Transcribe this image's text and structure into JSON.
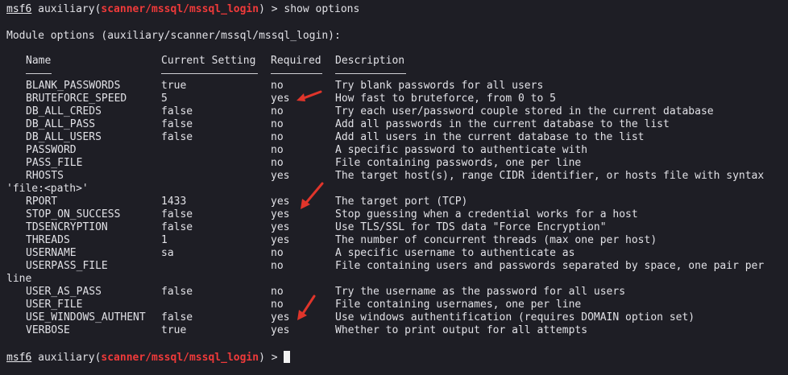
{
  "terminal": {
    "prompt_name": "msf6",
    "prompt_module_prefix": " auxiliary(",
    "module_path": "scanner/mssql/mssql_login",
    "prompt_suffix": ") > ",
    "command": "show options",
    "options_title": "Module options (auxiliary/scanner/mssql/mssql_login):",
    "cursor_prompt_suffix": ") > "
  },
  "table": {
    "headers": {
      "name": "Name",
      "current": "Current Setting",
      "required": "Required",
      "description": "Description"
    },
    "rows": [
      {
        "name": "BLANK_PASSWORDS",
        "current": "true",
        "required": "no",
        "description": "Try blank passwords for all users"
      },
      {
        "name": "BRUTEFORCE_SPEED",
        "current": "5",
        "required": "yes",
        "description": "How fast to bruteforce, from 0 to 5"
      },
      {
        "name": "DB_ALL_CREDS",
        "current": "false",
        "required": "no",
        "description": "Try each user/password couple stored in the current database"
      },
      {
        "name": "DB_ALL_PASS",
        "current": "false",
        "required": "no",
        "description": "Add all passwords in the current database to the list"
      },
      {
        "name": "DB_ALL_USERS",
        "current": "false",
        "required": "no",
        "description": "Add all users in the current database to the list"
      },
      {
        "name": "PASSWORD",
        "current": "",
        "required": "no",
        "description": "A specific password to authenticate with"
      },
      {
        "name": "PASS_FILE",
        "current": "",
        "required": "no",
        "description": "File containing passwords, one per line"
      },
      {
        "name": "RHOSTS",
        "current": "",
        "required": "yes",
        "description": "The target host(s), range CIDR identifier, or hosts file with syntax"
      },
      {
        "name": "",
        "current": "",
        "required": "",
        "description": "",
        "wrap": "'file:<path>'"
      },
      {
        "name": "RPORT",
        "current": "1433",
        "required": "yes",
        "description": "The target port (TCP)"
      },
      {
        "name": "STOP_ON_SUCCESS",
        "current": "false",
        "required": "yes",
        "description": "Stop guessing when a credential works for a host"
      },
      {
        "name": "TDSENCRYPTION",
        "current": "false",
        "required": "yes",
        "description": "Use TLS/SSL for TDS data \"Force Encryption\""
      },
      {
        "name": "THREADS",
        "current": "1",
        "required": "yes",
        "description": "The number of concurrent threads (max one per host)"
      },
      {
        "name": "USERNAME",
        "current": "sa",
        "required": "no",
        "description": "A specific username to authenticate as"
      },
      {
        "name": "USERPASS_FILE",
        "current": "",
        "required": "no",
        "description": "File containing users and passwords separated by space, one pair per"
      },
      {
        "name": "",
        "current": "",
        "required": "",
        "description": "",
        "wrap": "line"
      },
      {
        "name": "USER_AS_PASS",
        "current": "false",
        "required": "no",
        "description": "Try the username as the password for all users"
      },
      {
        "name": "USER_FILE",
        "current": "",
        "required": "no",
        "description": "File containing usernames, one per line"
      },
      {
        "name": "USE_WINDOWS_AUTHENT",
        "current": "false",
        "required": "yes",
        "description": "Use windows authentification (requires DOMAIN option set)"
      },
      {
        "name": "VERBOSE",
        "current": "true",
        "required": "yes",
        "description": "Whether to print output for all attempts"
      }
    ]
  },
  "annotations": {
    "arrow_color": "#e0352b",
    "arrow_icon": "red-arrow-icon"
  }
}
